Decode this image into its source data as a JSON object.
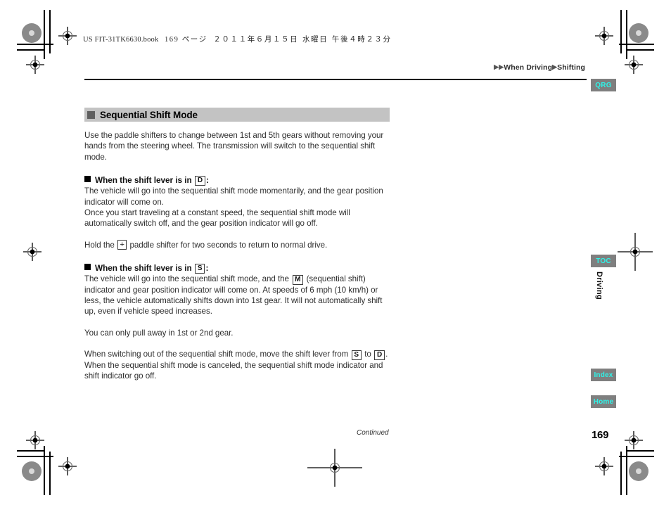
{
  "print_header": {
    "book_file": "US FIT-31TK6630.book",
    "page_label": "169 ページ",
    "date": "２０１１年６月１５日",
    "weekday": "水曜日",
    "time": "午後４時２３分"
  },
  "breadcrumb": {
    "arrow1": "▶▶",
    "item1": "When Driving",
    "arrow2": "▶",
    "item2": "Shifting"
  },
  "section": {
    "title": "Sequential Shift Mode",
    "intro": "Use the paddle shifters to change between 1st and 5th gears without removing your hands from the steering wheel. The transmission will switch to the sequential shift mode.",
    "sub_d": {
      "label_pre": "When the shift lever is in",
      "key": "D",
      "label_post": ":",
      "para1": "The vehicle will go into the sequential shift mode momentarily, and the gear position indicator will come on.",
      "para2": "Once you start traveling at a constant speed, the sequential shift mode will automatically switch off, and the gear position indicator will go off.",
      "para3_pre": "Hold the",
      "para3_key": "+",
      "para3_post": "paddle shifter for two seconds to return to normal drive."
    },
    "sub_s": {
      "label_pre": "When the shift lever is in",
      "key": "S",
      "label_post": ":",
      "para1_pre": "The vehicle will go into the sequential shift mode, and the",
      "para1_key": "M",
      "para1_post": "(sequential shift) indicator and gear position indicator will come on. At speeds of 6 mph (10 km/h) or less, the vehicle automatically shifts down into 1st gear. It will not automatically shift up, even if vehicle speed increases.",
      "para2": "You can only pull away in 1st or 2nd gear.",
      "para3_pre": "When switching out of the sequential shift mode, move the shift lever from",
      "para3_key1": "S",
      "para3_mid": "to",
      "para3_key2": "D",
      "para3_post": ". When the sequential shift mode is canceled, the sequential shift mode indicator and shift indicator go off."
    }
  },
  "nav_tabs": {
    "qrg": "QRG",
    "toc": "TOC",
    "index": "Index",
    "home": "Home",
    "chapter_label": "Driving",
    "tab_bg": "#7f7f7f",
    "tab_text_color": "#2ff3e8"
  },
  "footer": {
    "continued": "Continued",
    "page_number": "169"
  }
}
